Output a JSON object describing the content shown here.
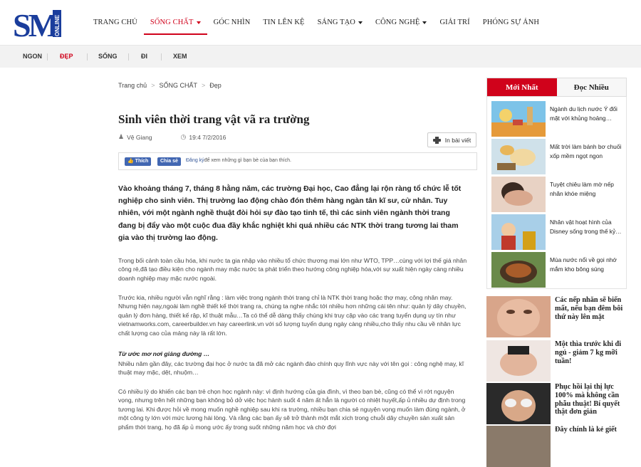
{
  "logo": {
    "letters": "SM",
    "sub": "ONLINE"
  },
  "nav": [
    {
      "label": "TRANG CHỦ"
    },
    {
      "label": "SỐNG CHẤT",
      "caret": true,
      "active": true
    },
    {
      "label": "GÓC NHÌN"
    },
    {
      "label": "TIN LÊN KỆ"
    },
    {
      "label": "SÁNG TẠO",
      "caret": true
    },
    {
      "label": "CÔNG NGHỆ",
      "caret": true
    },
    {
      "label": "GIẢI TRÍ"
    },
    {
      "label": "PHÓNG SỰ ẢNH"
    }
  ],
  "subnav": [
    "NGON",
    "ĐẸP",
    "SỐNG",
    "ĐI",
    "XEM"
  ],
  "breadcrumb": [
    "Trang chủ",
    "SỐNG CHẤT",
    "Đẹp"
  ],
  "article": {
    "title": "Sinh viên thời trang vật vã ra trường",
    "author": "Vệ Giang",
    "datetime": "19:4 7/2/2016",
    "print_label": "In bài viết",
    "fb_like": "Thích",
    "fb_share": "Chia sẻ",
    "fb_register": "Đăng ký",
    "fb_text": "để xem những gì bạn bè của bạn thích.",
    "lead": "Vào khoảng tháng 7, tháng 8 hằng năm, các trường Đại học, Cao đẳng lại rộn ràng tổ chức lễ tốt nghiệp cho sinh viên. Thị trường lao động chào đón thêm hàng ngàn tân kĩ sư, cử nhân. Tuy nhiên, với một ngành nghề thuật đòi hỏi sự đào tạo tinh tế, thì các sinh viên ngành thời trang đang bị đẩy vào một cuộc đua đầy khắc nghiệt khi quá nhiều các NTK thời trang tương lai tham gia vào thị trường lao động.",
    "p1": "Trong bối cảnh toàn cầu hóa, khi nước ta gia nhập vào nhiều tổ chức thương mại lớn như WTO, TPP…cùng với lợi thế giá nhân công rẻ,đã tạo điều kiện cho ngành may mặc nước ta phát triển theo hướng công nghiệp hóa,với sự xuất hiện ngày càng nhiều doanh nghiệp may mặc nước ngoài.",
    "p2": "Trước kia, nhiều người vẫn nghĩ rằng : làm việc trong ngành thời trang chỉ là NTK thời trang hoặc thợ may, công nhân may. Nhưng hiện nay,ngoài làm nghề thiết kế thời trang ra, chúng ta nghe nhắc tới nhiều hơn những cái tên như: quản lý dây chuyền, quản lý đơn hàng, thiết kế rập, kĩ thuật mẫu…Ta có thể dễ dàng thấy chúng khi truy cập vào các trang tuyển dụng uy tín như vietnamworks.com, careerbuilder.vn hay careerlink.vn với số lượng tuyển dụng ngày càng nhiều,cho thấy nhu cầu về nhân lực chất lượng cao của mảng này là rất lớn.",
    "p3_title": "Từ ước mơ nơi giảng đường …",
    "p3": "Nhiều năm gần đây, các trường đại học ở nước ta đã mở các ngành đào chính quy lĩnh vực này với tên gọi : công nghệ may, kĩ thuật may mặc, dệt, nhuộm…",
    "p4": "Có nhiều lý do khiến các bạn trẻ chọn học ngành này: vì định hướng của gia đình, vì theo bạn bè, cũng có thể vì rớt nguyện vọng, nhưng trên hết những bạn không bỏ dở việc học hành suốt 4 năm ất hẳn là người có nhiệt huyết,ấp ủ nhiều dự định trong tương lai. Khi được hỏi về mong muốn nghề nghiệp sau khi ra trường, nhiều bạn chia sẻ nguyện vọng muốn làm đúng ngành, ở một công ty lớn với mức lương hài lòng. Và rằng các bạn ấy sẽ trở thành một mắt xích trong chuỗi dây chuyền sản xuất sản phẩm thời trang, họ đã ấp ủ mong ước ấy trong suốt những năm học và chờ đợi"
  },
  "sidebar": {
    "tab_new": "Mới Nhất",
    "tab_read": "Đọc Nhiều",
    "items": [
      "Ngành du lịch nước Ý đối mặt với khủng hoảng…",
      "Mất trời làm bánh bơ chuối xốp mềm ngọt ngon",
      "Tuyệt chiêu làm mờ nếp nhăn khóe miệng",
      "Nhân vật hoạt hình của Disney sống trong thế kỷ…",
      "Mùa nước nổi về gọi nhớ mắm kho bông súng"
    ],
    "big_items": [
      "Các nếp nhăn sẽ biến mất, nếu bạn đêm bôi thứ này lên mặt",
      "Một thìa trước khi đi ngủ - giảm 7 kg mỡi tuần!",
      "Phục hồi lại thị lực 100% mà không cần phẫu thuật! Bí quyết thật đơn giản",
      "Đây chính là kẻ giết"
    ]
  },
  "colors": {
    "accent": "#d0021b",
    "logo_blue": "#1a3d9c",
    "fb_blue": "#4267b2"
  }
}
